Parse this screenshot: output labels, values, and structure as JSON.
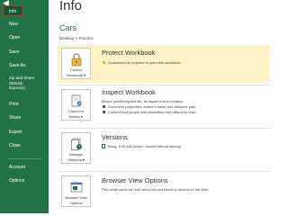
{
  "sidebar": {
    "items": [
      {
        "label": "Info"
      },
      {
        "label": "New"
      },
      {
        "label": "Open"
      },
      {
        "label": "Save"
      },
      {
        "label": "Save As"
      },
      {
        "label_lines": [
          "Zip and Share",
          "(WinZip",
          "Express)"
        ]
      },
      {
        "label": "Print"
      },
      {
        "label": "Share"
      },
      {
        "label": "Export"
      },
      {
        "label": "Close"
      },
      {
        "label": "Account"
      },
      {
        "label": "Options"
      }
    ]
  },
  "header": {
    "title": "Info",
    "doc_title": "Cars",
    "breadcrumb": "Desktop » Practice"
  },
  "protect": {
    "button_lines": [
      "Protect",
      "Workbook ▾"
    ],
    "title": "Protect Workbook",
    "note": "A password is required to open this workbook."
  },
  "inspect": {
    "button_lines": [
      "Check for",
      "Issues ▾"
    ],
    "title": "Inspect Workbook",
    "intro": "Before publishing this file, be aware that it contains:",
    "bullets": [
      "Document properties, author's name and absolute path",
      "Content that people with disabilities find difficult to read"
    ]
  },
  "versions": {
    "button_lines": [
      "Manage",
      "Versions ▾"
    ],
    "title": "Versions",
    "entry": "Today, 5:32 AM (when I closed without saving)"
  },
  "browser": {
    "button_lines": [
      "Browser View",
      "Options"
    ],
    "title": "Browser View Options",
    "desc": "Pick what users can see when this workbook is viewed on the Web."
  },
  "colors": {
    "sidebar": "#217346",
    "active_item": "#0b5a2f",
    "highlight": "#fdf3c7",
    "accent": "#217346",
    "focus_border": "#d13438"
  }
}
